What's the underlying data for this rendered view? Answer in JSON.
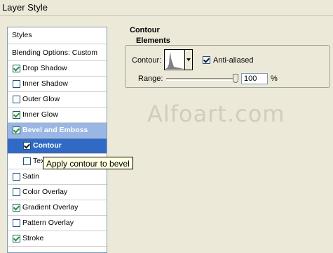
{
  "window": {
    "title": "Layer Style"
  },
  "sidebar": {
    "header": "Styles",
    "blending": "Blending Options: Custom",
    "items": [
      {
        "label": "Drop Shadow",
        "checked": true
      },
      {
        "label": "Inner Shadow",
        "checked": false
      },
      {
        "label": "Outer Glow",
        "checked": false
      },
      {
        "label": "Inner Glow",
        "checked": true
      },
      {
        "label": "Bevel and Emboss",
        "checked": true,
        "state": "selected-parent"
      },
      {
        "label": "Contour",
        "checked": true,
        "state": "selected",
        "sub": true
      },
      {
        "label": "Texture",
        "checked": false,
        "sub": true
      },
      {
        "label": "Satin",
        "checked": false
      },
      {
        "label": "Color Overlay",
        "checked": false
      },
      {
        "label": "Gradient Overlay",
        "checked": true
      },
      {
        "label": "Pattern Overlay",
        "checked": false
      },
      {
        "label": "Stroke",
        "checked": true
      }
    ]
  },
  "tooltip": "Apply contour to bevel",
  "contour_panel": {
    "section_title": "Contour",
    "group_title": "Elements",
    "contour_label": "Contour:",
    "antialiased_label": "Anti-aliased",
    "antialiased_checked": true,
    "range_label": "Range:",
    "range_value": "100",
    "range_unit": "%"
  },
  "watermark": "Alfoart.com",
  "colors": {
    "selected": "#316ac5",
    "selected_parent": "#99b6e4",
    "check_green": "#21a121",
    "dialog_bg": "#ece9d8"
  }
}
